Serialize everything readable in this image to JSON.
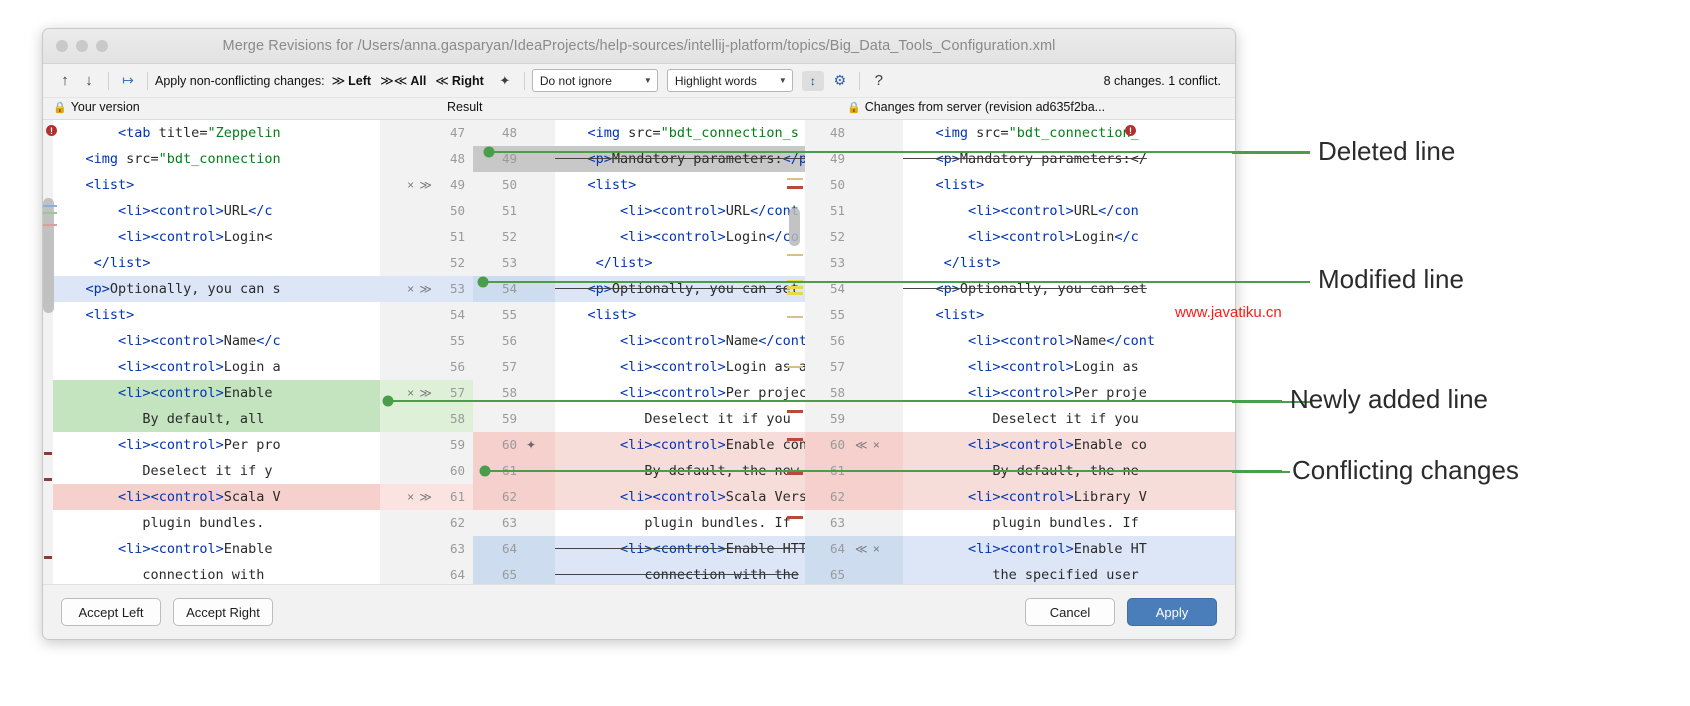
{
  "window": {
    "title": "Merge Revisions for /Users/anna.gasparyan/IdeaProjects/help-sources/intellij-platform/topics/Big_Data_Tools_Configuration.xml"
  },
  "toolbar": {
    "prev_icon": "↑",
    "next_icon": "↓",
    "apply_all_icon": "↦",
    "apply_label": "Apply non-conflicting changes:",
    "apply_left": {
      "chev": "≫",
      "label": "Left"
    },
    "apply_all": {
      "chev": "≫≪",
      "label": "All"
    },
    "apply_right": {
      "chev": "≪",
      "label": "Right"
    },
    "magic_icon": "✦",
    "ignore_select": {
      "value": "Do not ignore",
      "caret": "▼"
    },
    "highlight_select": {
      "value": "Highlight words",
      "caret": "▼"
    },
    "collapse_icon": "↕",
    "settings_icon": "⚙",
    "help_icon": "?",
    "status": "8 changes. 1 conflict."
  },
  "pane_headers": {
    "left": {
      "lock": "🔒",
      "label": "Your version"
    },
    "center": {
      "label": "Result"
    },
    "right": {
      "lock": "🔒",
      "label": "Changes from server (revision ad635f2ba..."
    }
  },
  "left_pane": {
    "rows": [
      {
        "num": "47",
        "text": "        <tab title=\"Zeppelin",
        "kind": "none",
        "actions": ""
      },
      {
        "num": "48",
        "text": "    <img src=\"bdt_connection",
        "kind": "none",
        "actions": ""
      },
      {
        "num": "49",
        "text": "    <list>",
        "kind": "grey",
        "actions": "× ≫"
      },
      {
        "num": "50",
        "text": "        <li><control>URL</c",
        "kind": "none",
        "actions": ""
      },
      {
        "num": "51",
        "text": "        <li><control>Login<",
        "kind": "none",
        "actions": ""
      },
      {
        "num": "52",
        "text": "     </list>",
        "kind": "none",
        "actions": ""
      },
      {
        "num": "53",
        "text": "    <p>Optionally, you can s",
        "kind": "blue",
        "actions": "× ≫"
      },
      {
        "num": "54",
        "text": "    <list>",
        "kind": "none",
        "actions": ""
      },
      {
        "num": "55",
        "text": "        <li><control>Name</c",
        "kind": "none",
        "actions": ""
      },
      {
        "num": "56",
        "text": "        <li><control>Login a",
        "kind": "none",
        "actions": ""
      },
      {
        "num": "57",
        "text": "        <li><control>Enable",
        "kind": "green",
        "actions": "× ≫"
      },
      {
        "num": "58",
        "text": "           By default, all",
        "kind": "green",
        "actions": ""
      },
      {
        "num": "59",
        "text": "        <li><control>Per pro",
        "kind": "none",
        "actions": ""
      },
      {
        "num": "60",
        "text": "           Deselect it if y",
        "kind": "none",
        "actions": ""
      },
      {
        "num": "61",
        "text": "        <li><control>Scala V",
        "kind": "red",
        "actions": "× ≫"
      },
      {
        "num": "62",
        "text": "           plugin bundles.",
        "kind": "none",
        "actions": ""
      },
      {
        "num": "63",
        "text": "        <li><control>Enable",
        "kind": "none",
        "actions": ""
      },
      {
        "num": "64",
        "text": "           connection with",
        "kind": "none",
        "actions": ""
      }
    ]
  },
  "center_pane": {
    "rows": [
      {
        "num": "48",
        "text": "    <img src=\"bdt_connection_s",
        "kind": "none",
        "magic": ""
      },
      {
        "num": "49",
        "text": "    <p>Mandatory parameters:</p",
        "kind": "grey",
        "magic": ""
      },
      {
        "num": "50",
        "text": "    <list>",
        "kind": "none",
        "magic": ""
      },
      {
        "num": "51",
        "text": "        <li><control>URL</cont",
        "kind": "none",
        "magic": ""
      },
      {
        "num": "52",
        "text": "        <li><control>Login</co",
        "kind": "none",
        "magic": ""
      },
      {
        "num": "53",
        "text": "     </list>",
        "kind": "none",
        "magic": ""
      },
      {
        "num": "54",
        "text": "    <p>Optionally, you can set",
        "kind": "blue",
        "magic": ""
      },
      {
        "num": "55",
        "text": "    <list>",
        "kind": "none",
        "magic": ""
      },
      {
        "num": "56",
        "text": "        <li><control>Name</cont",
        "kind": "none",
        "magic": ""
      },
      {
        "num": "57",
        "text": "        <li><control>Login as a",
        "kind": "none",
        "magic": ""
      },
      {
        "num": "58",
        "text": "        <li><control>Per projec",
        "kind": "none",
        "magic": ""
      },
      {
        "num": "59",
        "text": "           Deselect it if you",
        "kind": "none",
        "magic": ""
      },
      {
        "num": "60",
        "text": "        <li><control>Enable con",
        "kind": "red",
        "magic": "✦"
      },
      {
        "num": "61",
        "text": "           By default, the new",
        "kind": "red",
        "magic": ""
      },
      {
        "num": "62",
        "text": "        <li><control>Scala Vers",
        "kind": "red",
        "magic": ""
      },
      {
        "num": "63",
        "text": "           plugin bundles. If",
        "kind": "none",
        "magic": ""
      },
      {
        "num": "64",
        "text": "        <li><control>Enable HTT",
        "kind": "blue",
        "magic": ""
      },
      {
        "num": "65",
        "text": "           connection with the",
        "kind": "blue",
        "magic": ""
      }
    ]
  },
  "right_pane": {
    "rows": [
      {
        "num": "48",
        "text": "    <img src=\"bdt_connection_",
        "kind": "none",
        "actions": ""
      },
      {
        "num": "49",
        "text": "    <p>Mandatory parameters:</",
        "kind": "none",
        "actions": ""
      },
      {
        "num": "50",
        "text": "    <list>",
        "kind": "none",
        "actions": ""
      },
      {
        "num": "51",
        "text": "        <li><control>URL</con",
        "kind": "none",
        "actions": ""
      },
      {
        "num": "52",
        "text": "        <li><control>Login</c",
        "kind": "none",
        "actions": ""
      },
      {
        "num": "53",
        "text": "     </list>",
        "kind": "none",
        "actions": ""
      },
      {
        "num": "54",
        "text": "    <p>Optionally, you can set",
        "kind": "none",
        "actions": ""
      },
      {
        "num": "55",
        "text": "    <list>",
        "kind": "none",
        "actions": ""
      },
      {
        "num": "56",
        "text": "        <li><control>Name</cont",
        "kind": "none",
        "actions": ""
      },
      {
        "num": "57",
        "text": "        <li><control>Login as ",
        "kind": "none",
        "actions": ""
      },
      {
        "num": "58",
        "text": "        <li><control>Per proje",
        "kind": "none",
        "actions": ""
      },
      {
        "num": "59",
        "text": "           Deselect it if you",
        "kind": "none",
        "actions": ""
      },
      {
        "num": "60",
        "text": "        <li><control>Enable co",
        "kind": "red",
        "actions": "≪ ×"
      },
      {
        "num": "61",
        "text": "           By default, the ne",
        "kind": "red",
        "actions": ""
      },
      {
        "num": "62",
        "text": "        <li><control>Library V",
        "kind": "red",
        "actions": ""
      },
      {
        "num": "63",
        "text": "           plugin bundles. If",
        "kind": "none",
        "actions": ""
      },
      {
        "num": "64",
        "text": "        <li><control>Enable HT",
        "kind": "blue",
        "actions": "≪ ×"
      },
      {
        "num": "65",
        "text": "           the specified user",
        "kind": "blue",
        "actions": ""
      }
    ]
  },
  "buttons": {
    "accept_left": "Accept Left",
    "accept_right": "Accept Right",
    "cancel": "Cancel",
    "apply": "Apply"
  },
  "annotations": [
    {
      "label": "Deleted line"
    },
    {
      "label": "Modified line"
    },
    {
      "label": "Newly added line"
    },
    {
      "label": "Conflicting changes"
    }
  ],
  "watermark": "www.javatiku.cn",
  "colors": {
    "added": "#c4e4c0",
    "deleted": "#c8c8c8",
    "modified": "#cedcf0",
    "conflict": "#f5d0cd",
    "accent": "#4a7ebb",
    "annotation_line": "#4a9d4a",
    "watermark": "#ff1a1a"
  }
}
